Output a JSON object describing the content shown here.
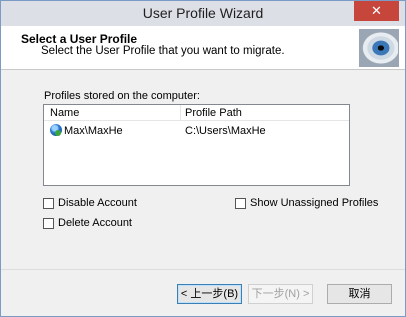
{
  "window": {
    "title": "User Profile Wizard",
    "close_glyph": "✕"
  },
  "header": {
    "title": "Select a User Profile",
    "subtitle": "Select the User Profile that you want to migrate.",
    "image_icon": "eye-image"
  },
  "profiles": {
    "caption": "Profiles stored on the computer:",
    "columns": [
      "Name",
      "Profile Path"
    ],
    "rows": [
      {
        "icon": "user-globe-icon",
        "name": "Max\\MaxHe",
        "path": "C:\\Users\\MaxHe"
      }
    ]
  },
  "options": {
    "disable_account": "Disable Account",
    "delete_account": "Delete Account",
    "show_unassigned": "Show Unassigned Profiles"
  },
  "buttons": {
    "back": "< 上一步(B)",
    "next": "下一步(N) >",
    "cancel": "取消"
  }
}
